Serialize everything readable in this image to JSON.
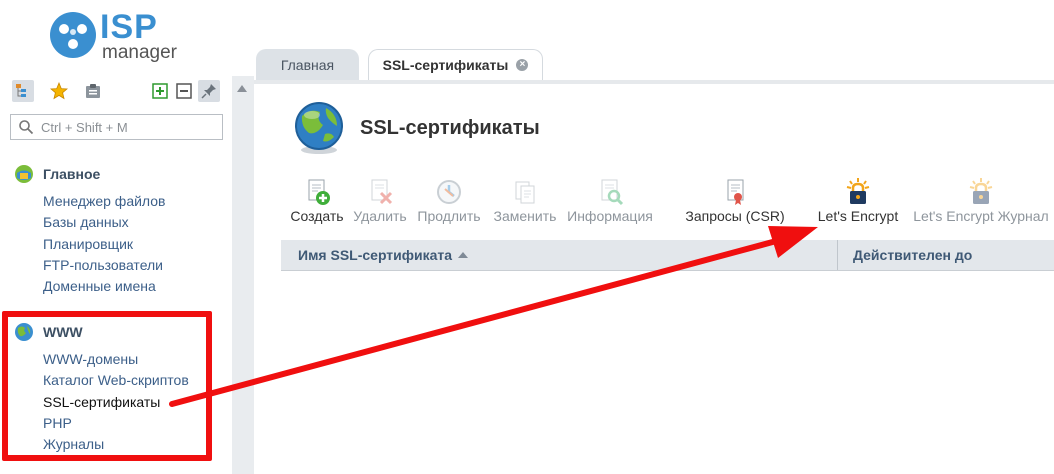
{
  "logo": {
    "brand_top": "ISP",
    "brand_bottom": "manager"
  },
  "search": {
    "placeholder": "Ctrl + Shift + M"
  },
  "sidebar": {
    "groups": [
      {
        "title": "Главное",
        "items": [
          "Менеджер файлов",
          "Базы данных",
          "Планировщик",
          "FTP-пользователи",
          "Доменные имена"
        ]
      },
      {
        "title": "WWW",
        "items": [
          "WWW-домены",
          "Каталог Web-скриптов",
          "SSL-сертификаты",
          "PHP",
          "Журналы"
        ]
      }
    ]
  },
  "tabs": [
    {
      "label": "Главная",
      "active": false
    },
    {
      "label": "SSL-сертификаты",
      "active": true
    }
  ],
  "page": {
    "title": "SSL-сертификаты"
  },
  "toolbar": [
    {
      "label": "Создать",
      "icon": "create-icon",
      "enabled": true
    },
    {
      "label": "Удалить",
      "icon": "delete-icon",
      "enabled": false
    },
    {
      "label": "Продлить",
      "icon": "renew-icon",
      "enabled": false
    },
    {
      "label": "Заменить",
      "icon": "replace-icon",
      "enabled": false
    },
    {
      "label": "Информация",
      "icon": "info-icon",
      "enabled": false
    },
    {
      "label": "Запросы (CSR)",
      "icon": "csr-icon",
      "enabled": true
    },
    {
      "label": "Let's Encrypt",
      "icon": "lock-icon",
      "enabled": true
    },
    {
      "label": "Let's Encrypt Журнал",
      "icon": "lock-log-icon",
      "enabled": false
    }
  ],
  "table": {
    "columns": [
      "Имя SSL-сертификата",
      "Действителен до"
    ],
    "sort_column": "Имя SSL-сертификата",
    "sort_direction": "ascending"
  },
  "colors": {
    "accent": "#3a8fd0",
    "link": "#3c5f89",
    "annotation_red": "#f00f0f"
  }
}
